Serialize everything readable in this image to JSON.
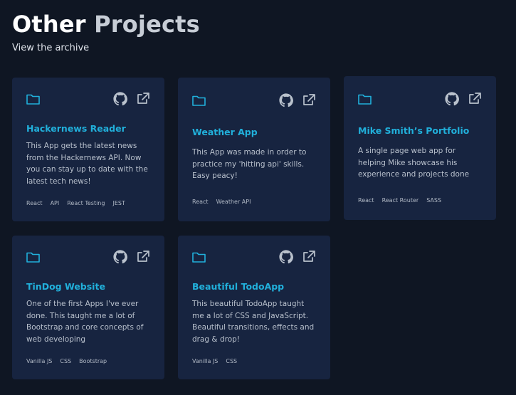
{
  "header": {
    "title_word1": "Other",
    "title_word2": "Projects",
    "archive_link": "View the archive"
  },
  "colors": {
    "background": "#0f1623",
    "card": "#172440",
    "accent": "#21b0db"
  },
  "icons": {
    "folder": "folder-icon",
    "github": "github-icon",
    "external": "external-link-icon"
  },
  "projects": [
    {
      "name": "Hackernews Reader",
      "description": "This App gets the latest news from the Hackernews API. Now you can stay up to date with the latest tech news!",
      "tags": [
        "React",
        "API",
        "React Testing",
        "JEST"
      ]
    },
    {
      "name": "Weather App",
      "description": "This App was made in order to practice my 'hitting api' skills. Easy peacy!",
      "tags": [
        "React",
        "Weather API"
      ]
    },
    {
      "name": "Mike Smith’s Portfolio",
      "description": "A single page web app for helping Mike showcase his experience and projects done",
      "tags": [
        "React",
        "React Router",
        "SASS"
      ]
    },
    {
      "name": "TinDog Website",
      "description": "One of the first Apps I've ever done. This taught me a lot of Bootstrap and core concepts of web developing",
      "tags": [
        "Vanilla JS",
        "CSS",
        "Bootstrap"
      ]
    },
    {
      "name": "Beautiful TodoApp",
      "description": "This beautiful TodoApp taught me a lot of CSS and JavaScript. Beautiful transitions, effects and drag & drop!",
      "tags": [
        "Vanilla JS",
        "CSS"
      ]
    }
  ]
}
